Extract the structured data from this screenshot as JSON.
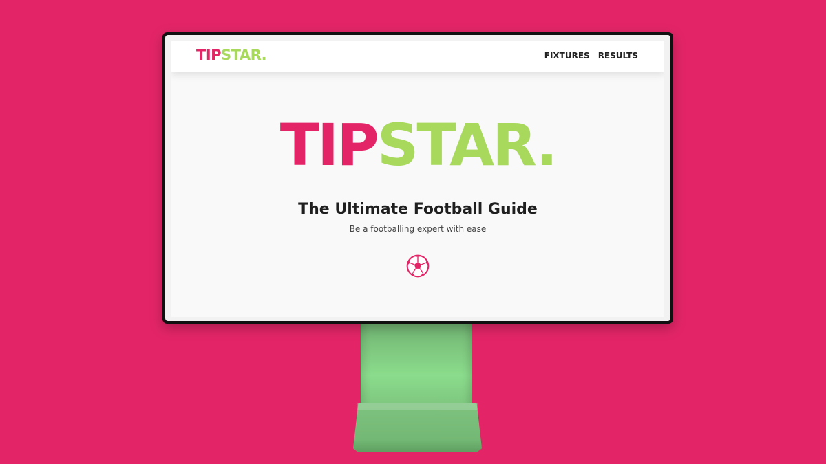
{
  "brand": {
    "name_part1": "TIP",
    "name_part2": "STAR.",
    "pink": "#E32567",
    "green": "#A8D95C"
  },
  "nav": {
    "links": [
      "FIXTURES",
      "RESULTS"
    ]
  },
  "hero": {
    "title": "The Ultimate Football Guide",
    "subtitle": "Be a footballing expert with ease",
    "icon": "football-icon"
  },
  "colors": {
    "background": "#E32567",
    "stand": "#7BC37C"
  }
}
